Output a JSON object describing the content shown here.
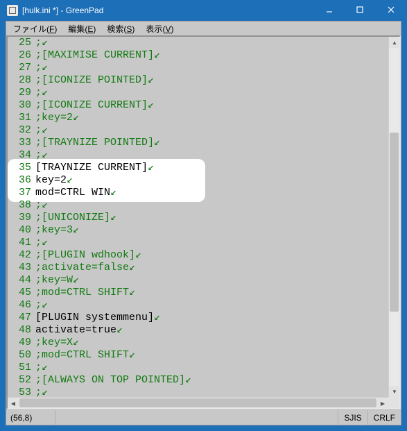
{
  "titlebar": {
    "title": "[hulk.ini *] - GreenPad"
  },
  "menubar": {
    "file": {
      "label": "ファイル",
      "accel": "F"
    },
    "edit": {
      "label": "編集",
      "accel": "E"
    },
    "search": {
      "label": "検索",
      "accel": "S"
    },
    "view": {
      "label": "表示",
      "accel": "V"
    }
  },
  "editor": {
    "first_line": 25,
    "highlight": {
      "from_line": 35,
      "to_line": 37
    },
    "lines": [
      {
        "kind": "comment",
        "text": ";"
      },
      {
        "kind": "comment",
        "text": ";[MAXIMISE CURRENT]"
      },
      {
        "kind": "comment",
        "text": ";"
      },
      {
        "kind": "comment",
        "text": ";[ICONIZE POINTED]"
      },
      {
        "kind": "comment",
        "text": ";"
      },
      {
        "kind": "comment",
        "text": ";[ICONIZE CURRENT]"
      },
      {
        "kind": "comment",
        "text": ";key=2"
      },
      {
        "kind": "comment",
        "text": ";"
      },
      {
        "kind": "comment",
        "text": ";[TRAYNIZE POINTED]"
      },
      {
        "kind": "comment",
        "text": ";"
      },
      {
        "kind": "normal",
        "text": "[TRAYNIZE CURRENT]"
      },
      {
        "kind": "normal",
        "text": "key=2"
      },
      {
        "kind": "normal",
        "text": "mod=CTRL WIN"
      },
      {
        "kind": "comment",
        "text": ";"
      },
      {
        "kind": "comment",
        "text": ";[UNICONIZE]"
      },
      {
        "kind": "comment",
        "text": ";key=3"
      },
      {
        "kind": "comment",
        "text": ";"
      },
      {
        "kind": "comment",
        "text": ";[PLUGIN wdhook]"
      },
      {
        "kind": "comment",
        "text": ";activate=false"
      },
      {
        "kind": "comment",
        "text": ";key=W"
      },
      {
        "kind": "comment",
        "text": ";mod=CTRL SHIFT"
      },
      {
        "kind": "comment",
        "text": ";"
      },
      {
        "kind": "normal",
        "text": "[PLUGIN systemmenu]"
      },
      {
        "kind": "normal",
        "text": "activate=true"
      },
      {
        "kind": "comment",
        "text": ";key=X"
      },
      {
        "kind": "comment",
        "text": ";mod=CTRL SHIFT"
      },
      {
        "kind": "comment",
        "text": ";"
      },
      {
        "kind": "comment",
        "text": ";[ALWAYS ON TOP POINTED]"
      },
      {
        "kind": "comment",
        "text": ";"
      }
    ]
  },
  "scrollbar": {
    "v_thumb_top_pct": 25,
    "v_thumb_height_pct": 53
  },
  "status": {
    "position": "(56,8)",
    "encoding": "SJIS",
    "eol": "CRLF"
  }
}
